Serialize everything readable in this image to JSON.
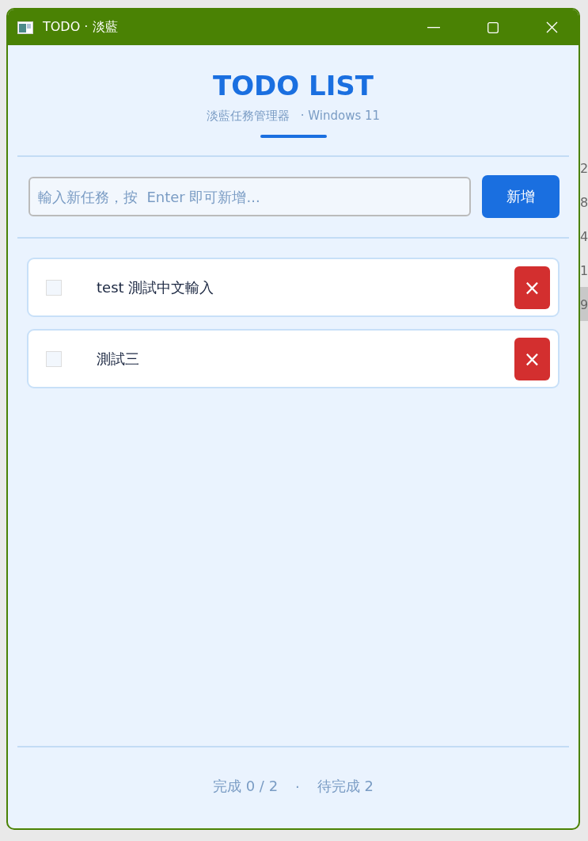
{
  "window": {
    "title": "TODO · 淡藍"
  },
  "header": {
    "title": "TODO LIST",
    "subtitle": "淡藍任務管理器",
    "platform": "· Windows 11"
  },
  "new_task": {
    "placeholder": "輸入新任務，按  Enter 即可新增...",
    "button": "新增"
  },
  "tasks": [
    {
      "text": "test 測試中文輸入",
      "checked": false,
      "delete": "×"
    },
    {
      "text": "測試三",
      "checked": false,
      "delete": "×"
    }
  ],
  "footer": {
    "done": "完成  0 / 2",
    "separator": "·",
    "pending": "待完成  2"
  },
  "background_rows": [
    {
      "text": "2",
      "selected": false
    },
    {
      "text": "8",
      "selected": false
    },
    {
      "text": "4",
      "selected": false
    },
    {
      "text": "1",
      "selected": false
    },
    {
      "text": "9",
      "selected": true
    }
  ]
}
